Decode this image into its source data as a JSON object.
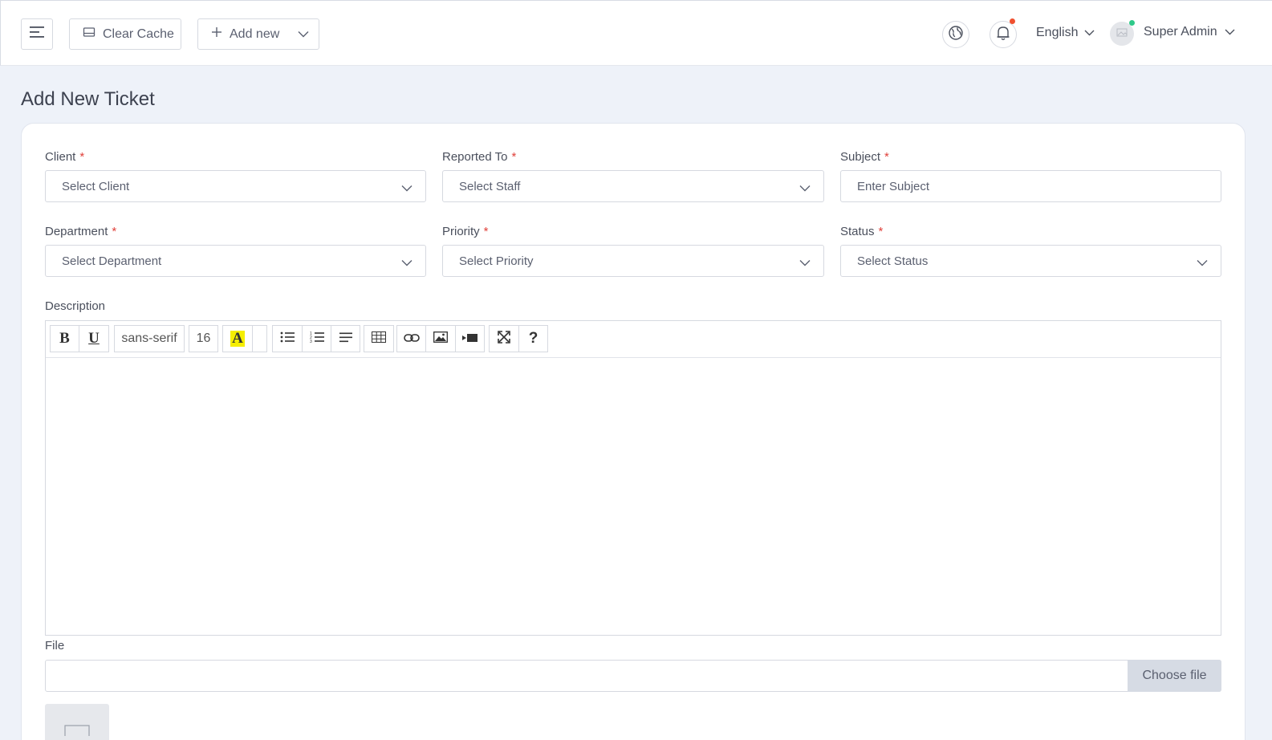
{
  "topbar": {
    "clear_cache": "Clear Cache",
    "add_new": "Add new",
    "language": "English",
    "user_name": "Super Admin",
    "notification_dot_color": "#f0502f",
    "online_dot_color": "#2fc989"
  },
  "page": {
    "title": "Add New Ticket"
  },
  "form": {
    "client": {
      "label": "Client",
      "placeholder": "Select Client"
    },
    "reported_to": {
      "label": "Reported To",
      "placeholder": "Select Staff"
    },
    "subject": {
      "label": "Subject",
      "placeholder": "Enter Subject"
    },
    "department": {
      "label": "Department",
      "placeholder": "Select Department"
    },
    "priority": {
      "label": "Priority",
      "placeholder": "Select Priority"
    },
    "status": {
      "label": "Status",
      "placeholder": "Select Status"
    },
    "required_mark": "*",
    "description": {
      "label": "Description",
      "toolbar": {
        "bold": "B",
        "underline": "U",
        "font_family": "sans-serif",
        "font_size": "16",
        "color_letter": "A",
        "help": "?"
      }
    },
    "file": {
      "label": "File",
      "button": "Choose file"
    }
  },
  "colors": {
    "background": "#eef2f9",
    "required": "#e0413b",
    "highlight": "#f5ee00"
  }
}
